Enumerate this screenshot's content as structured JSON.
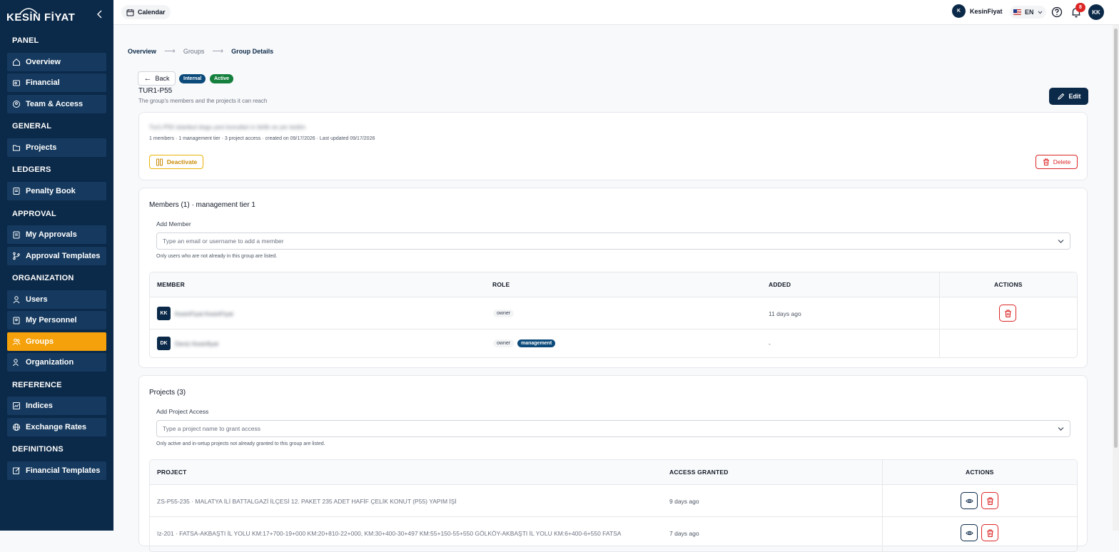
{
  "sidebar": {
    "logo_text": "KESİN FİYAT",
    "sections": [
      {
        "title": "PANEL",
        "items": [
          {
            "label": "Overview",
            "icon": "home-icon"
          },
          {
            "label": "Financial",
            "icon": "wallet-icon"
          },
          {
            "label": "Team & Access",
            "icon": "shield-user-icon"
          }
        ]
      },
      {
        "title": "GENERAL",
        "items": [
          {
            "label": "Projects",
            "icon": "folder-icon"
          }
        ]
      },
      {
        "title": "LEDGERS",
        "items": [
          {
            "label": "Penalty Book",
            "icon": "book-icon"
          }
        ]
      },
      {
        "title": "APPROVAL",
        "items": [
          {
            "label": "My Approvals",
            "icon": "clipboard-icon"
          },
          {
            "label": "Approval Templates",
            "icon": "branch-icon"
          }
        ]
      },
      {
        "title": "ORGANIZATION",
        "items": [
          {
            "label": "Users",
            "icon": "user-icon"
          },
          {
            "label": "My Personnel",
            "icon": "clipboard-user-icon"
          },
          {
            "label": "Groups",
            "icon": "users-icon"
          },
          {
            "label": "Organization",
            "icon": "user-cog-icon"
          }
        ]
      },
      {
        "title": "REFERENCE",
        "items": [
          {
            "label": "Indices",
            "icon": "chart-icon"
          },
          {
            "label": "Exchange Rates",
            "icon": "globe-icon"
          }
        ]
      },
      {
        "title": "DEFINITIONS",
        "items": [
          {
            "label": "Financial Templates",
            "icon": "template-icon"
          }
        ]
      }
    ],
    "active_item": "Groups"
  },
  "topbar": {
    "calendar_label": "Calendar",
    "user_initial": "K",
    "user_name": "KesinFiyat",
    "language": "EN",
    "notification_count": "8",
    "avatar_initials": "KK"
  },
  "breadcrumb": [
    "Overview",
    "Groups",
    "Group Details"
  ],
  "header": {
    "back_label": "Back",
    "badges": [
      {
        "label": "Internal",
        "color": "#0b4a7a"
      },
      {
        "label": "Active",
        "color": "#15803d"
      }
    ],
    "title": "TUR1-P55",
    "subtitle": "The group's members and the projects it can reach",
    "edit_label": "Edit"
  },
  "summary": {
    "description": "Tur1-P55 istanbul dogu yeni konutlari ic birlik ve yer teslim",
    "meta": "1 members · 1 management tier · 3 project access · created on 09/17/2026 · Last updated 09/17/2026",
    "deactivate_label": "Deactivate",
    "delete_label": "Delete"
  },
  "members": {
    "heading": "Members (1) · management tier 1",
    "add_label": "Add Member",
    "add_placeholder": "Type an email or username to add a member",
    "hint": "Only users who are not already in this group are listed.",
    "columns": [
      "MEMBER",
      "ROLE",
      "ADDED",
      "ACTIONS"
    ],
    "rows": [
      {
        "initials": "KK",
        "name": "KesinFiyat KesinFiyat",
        "roles": [
          "owner"
        ],
        "added": "11 days ago"
      },
      {
        "initials": "DK",
        "name": "Deniz Kesinfiyat",
        "roles": [
          "owner",
          "management"
        ],
        "added": "-"
      }
    ]
  },
  "projects": {
    "heading": "Projects (3)",
    "add_label": "Add Project Access",
    "add_placeholder": "Type a project name to grant access",
    "hint": "Only active and in-setup projects not already granted to this group are listed.",
    "columns": [
      "PROJECT",
      "ACCESS GRANTED",
      "ACTIONS"
    ],
    "rows": [
      {
        "name": "ZS-P55-235 · MALATYA İLİ BATTALGAZİ İLÇESİ 12. PAKET 235 ADET HAFİF ÇELİK KONUT (P55) YAPIM İŞİ",
        "granted": "9 days ago"
      },
      {
        "name": "Iz-201 · FATSA-AKBAŞTI İL YOLU KM:17+700-19+000 KM:20+810-22+000, KM:30+400-30+497 KM:55+150-55+550 GÖLKÖY-AKBAŞTI İL YOLU KM:6+400-6+550 FATSA",
        "granted": "7 days ago"
      }
    ]
  }
}
